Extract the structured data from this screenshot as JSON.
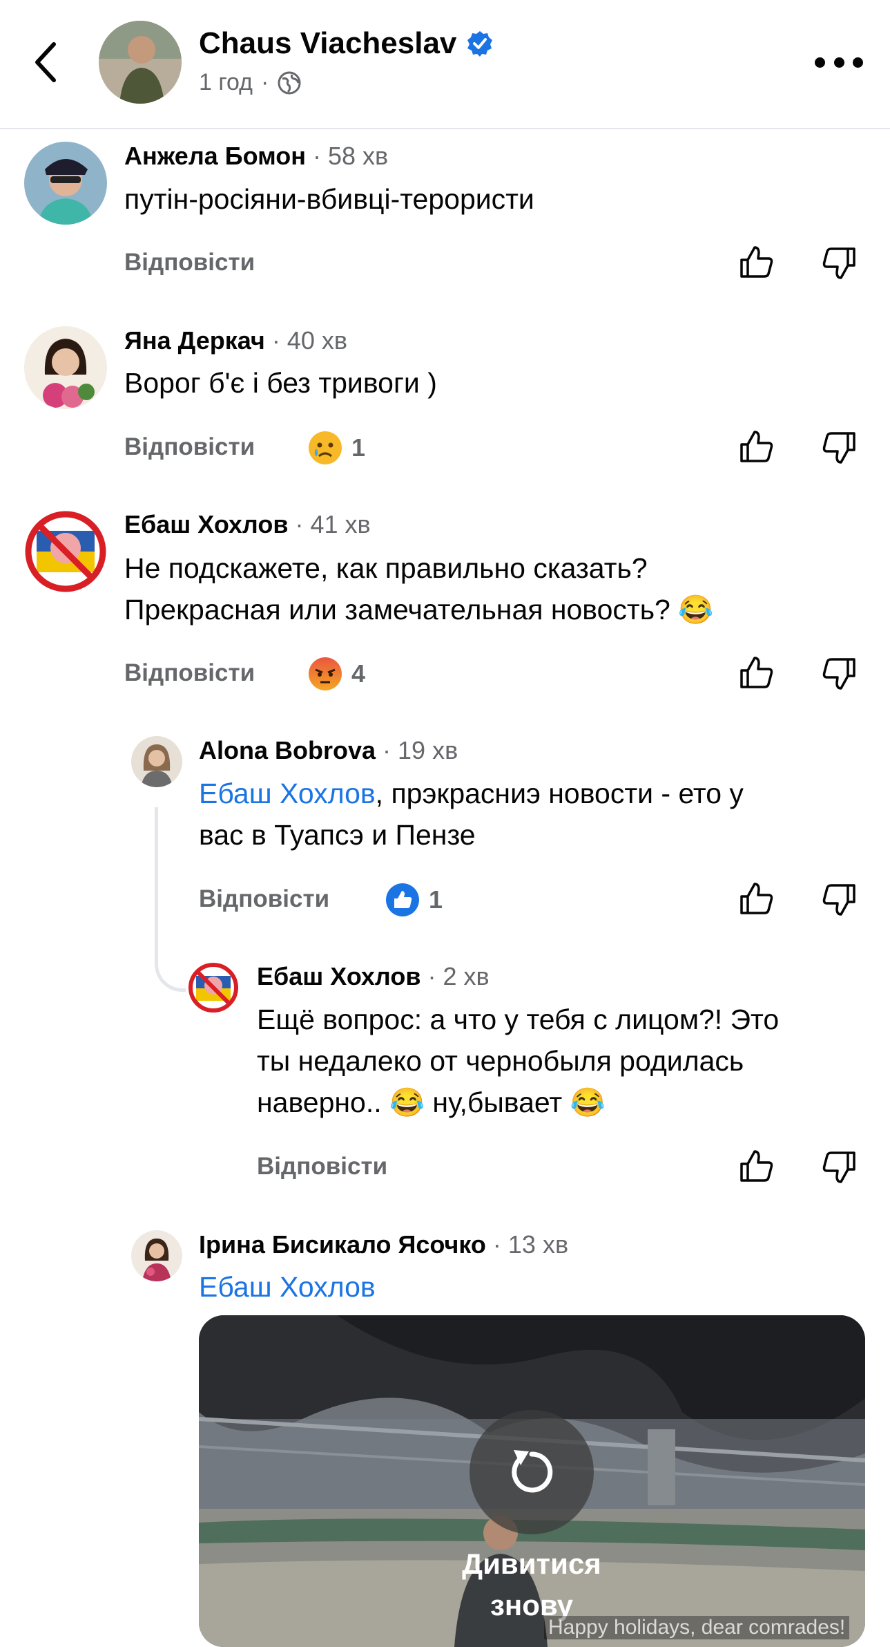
{
  "header": {
    "author": "Chaus Viacheslav",
    "meta_time": "1 год",
    "meta_sep": "·",
    "verified_color": "#1b74e4"
  },
  "reply_label": "Відповісти",
  "comments": [
    {
      "name": "Анжела Бомон",
      "time": "· 58 хв",
      "text": [
        "путін-росіяни-вбивці-терористи"
      ]
    },
    {
      "name": "Яна Деркач",
      "time": "· 40 хв",
      "text": [
        "Ворог б'є і без тривоги )"
      ],
      "reaction": {
        "icon": "sad-emoji",
        "count": "1"
      }
    },
    {
      "name": "Ебаш Хохлов",
      "time": "· 41 хв",
      "text": [
        "Не подскажете, как правильно сказать?",
        "Прекрасная или замечательная новость? 😂"
      ],
      "reaction": {
        "icon": "angry-emoji",
        "count": "4"
      }
    }
  ],
  "replies": [
    {
      "name": "Alona Bobrova",
      "time": "· 19 хв",
      "mention": "Ебаш Хохлов",
      "text": [
        ", прэкрасниэ новости - ето у",
        "вас в Туапсэ и Пензе"
      ],
      "reaction": {
        "icon": "like-emoji",
        "count": "1"
      }
    },
    {
      "name": "Ебаш Хохлов",
      "time": "· 2 хв",
      "text": [
        "Ещё вопрос: а что у тебя с лицом?! Это",
        "ты недалеко от чернобыля родилась",
        "наверно.. 😂 ну,бывает 😂"
      ]
    },
    {
      "name": "Ірина Бисикало Ясочко",
      "time": "· 13 хв",
      "mention": "Ебаш Хохлов"
    }
  ],
  "video": {
    "replay_label_line1": "Дивитися",
    "replay_label_line2": "знову",
    "caption": "Happy holidays, dear comrades!"
  },
  "colors": {
    "link": "#1b74e4",
    "secondary_text": "#65676b",
    "divider": "#e4e6eb"
  }
}
